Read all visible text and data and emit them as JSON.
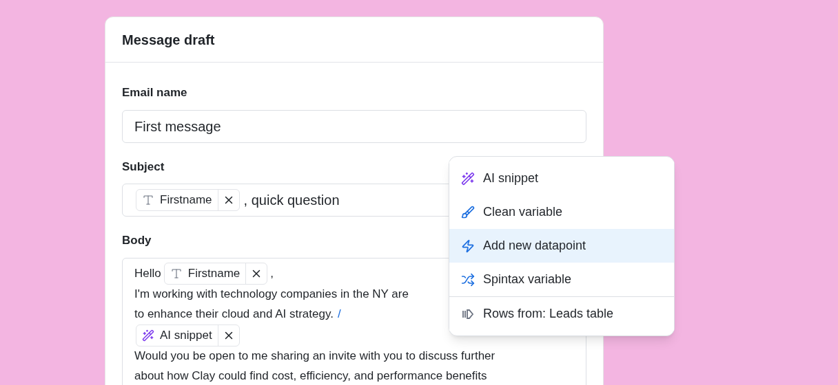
{
  "card": {
    "title": "Message draft"
  },
  "email_name": {
    "label": "Email name",
    "value": "First message"
  },
  "subject": {
    "label": "Subject",
    "chip": {
      "kind": "text",
      "label": "Firstname"
    },
    "after": ", quick question"
  },
  "body": {
    "label": "Body",
    "lines": [
      {
        "kind": "chip_line",
        "before": "Hello",
        "chip": {
          "kind": "text",
          "label": "Firstname"
        },
        "after": ","
      },
      {
        "kind": "text",
        "text": "I'm working with technology companies in the NY are"
      },
      {
        "kind": "text",
        "text": "to enhance their cloud and AI strategy.",
        "slash": "/"
      },
      {
        "kind": "chip_line",
        "chip": {
          "kind": "ai",
          "label": "AI snippet"
        }
      },
      {
        "kind": "text",
        "text": "Would you be open to me sharing an invite with you to discuss further"
      },
      {
        "kind": "text",
        "text": "about how Clay could find cost, efficiency, and performance benefits"
      }
    ]
  },
  "menu": {
    "items": [
      {
        "kind": "ai",
        "label": "AI snippet",
        "selected": false
      },
      {
        "kind": "clean",
        "label": "Clean variable",
        "selected": false
      },
      {
        "kind": "bolt",
        "label": "Add new datapoint",
        "selected": true
      },
      {
        "kind": "shuffle",
        "label": "Spintax variable",
        "selected": false
      },
      {
        "kind": "rows",
        "label": "Rows from: Leads table",
        "selected": false,
        "divider_before": true
      }
    ]
  }
}
